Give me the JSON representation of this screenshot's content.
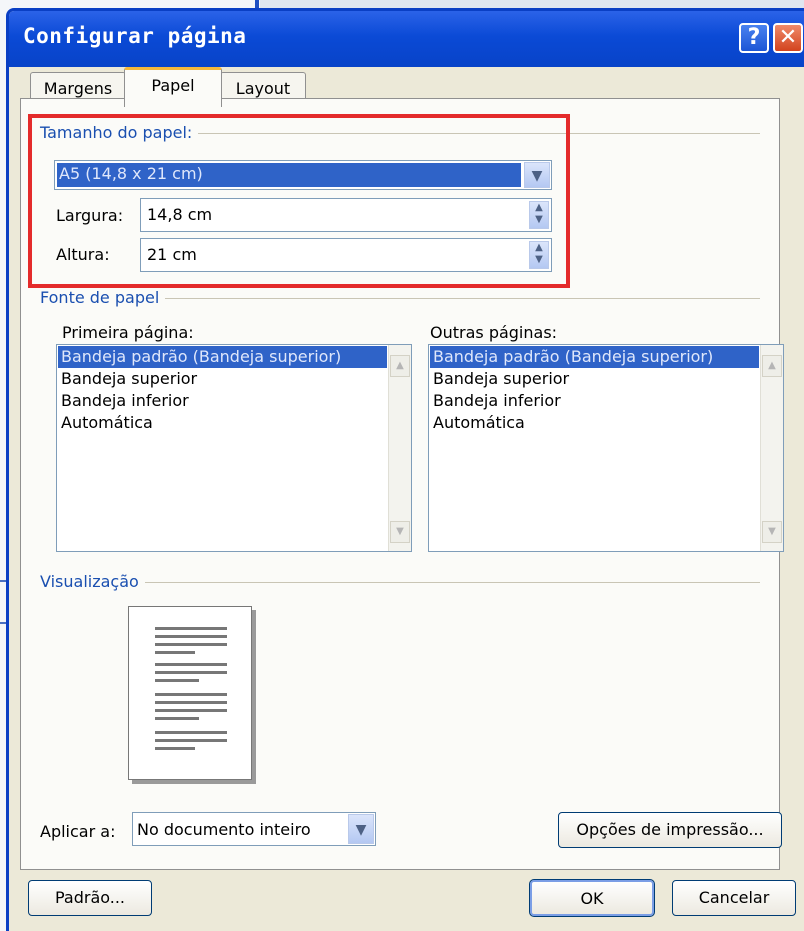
{
  "dialog": {
    "title": "Configurar página",
    "help_label": "?",
    "close_label": "✕"
  },
  "tabs": [
    {
      "label": "Margens",
      "active": false
    },
    {
      "label": "Papel",
      "active": true
    },
    {
      "label": "Layout",
      "active": false
    }
  ],
  "paper_size": {
    "section_label": "Tamanho do papel:",
    "selected": "A5 (14,8 x 21 cm)",
    "width_label": "Largura:",
    "width_value": "14,8 cm",
    "height_label": "Altura:",
    "height_value": "21 cm"
  },
  "paper_source": {
    "section_label": "Fonte de papel",
    "first_page_label": "Primeira página:",
    "other_pages_label": "Outras páginas:",
    "items": [
      "Bandeja padrão (Bandeja superior)",
      "Bandeja superior",
      "Bandeja inferior",
      "Automática"
    ],
    "selected_index": 0
  },
  "preview": {
    "section_label": "Visualização"
  },
  "apply_to": {
    "label": "Aplicar a:",
    "value": "No documento inteiro"
  },
  "buttons": {
    "print_options": "Opções de impressão...",
    "default": "Padrão...",
    "ok": "OK",
    "cancel": "Cancelar"
  },
  "colors": {
    "title_bar": "#0b4ad6",
    "selection": "#2f63c8",
    "highlight_box": "#e42b2b",
    "section_label": "#1a4fb0"
  }
}
